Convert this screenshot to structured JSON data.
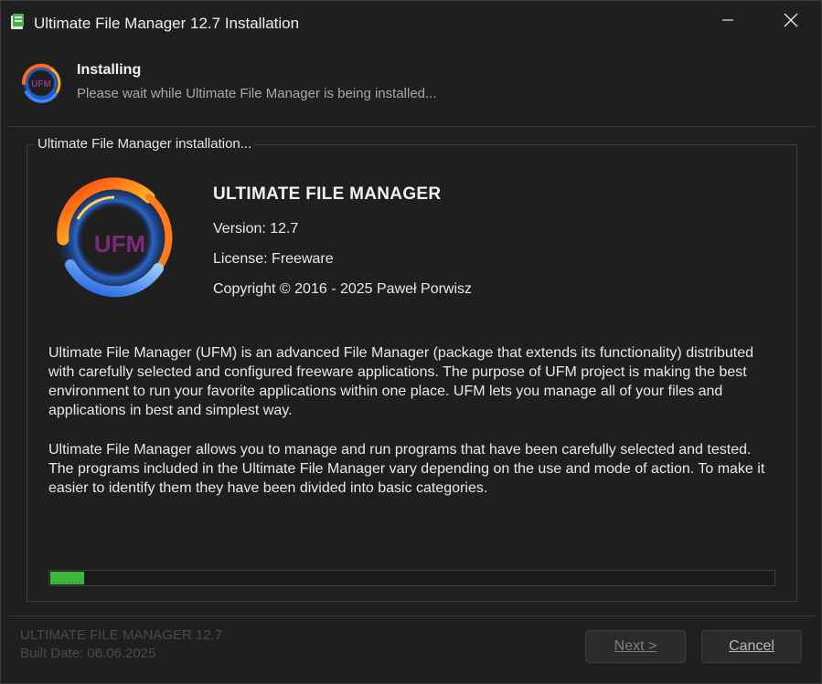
{
  "window": {
    "title": "Ultimate File Manager 12.7 Installation",
    "icons": {
      "app": "installer-app-icon",
      "minimize": "minimize-icon",
      "close": "close-icon"
    }
  },
  "header": {
    "title": "Installing",
    "subtitle": "Please wait while Ultimate File Manager is being installed...",
    "logo_text": "UFM"
  },
  "group": {
    "label": "Ultimate File Manager installation...",
    "logo_text": "UFM",
    "product_name": "ULTIMATE FILE MANAGER",
    "version": "Version: 12.7",
    "license": "License: Freeware",
    "copyright": "Copyright © 2016 - 2025 Paweł Porwisz",
    "description_1": "Ultimate File Manager (UFM) is an advanced File Manager (package that extends its functionality) distributed with carefully selected and configured freeware applications. The purpose of UFM project is making the best environment to run your favorite applications within one place. UFM lets you manage all of your files and applications in best and simplest way.",
    "description_2": "Ultimate File Manager allows you to manage and run programs that have been carefully selected and tested. The programs included in the Ultimate File Manager vary depending on the use and mode of action. To make it easier to identify them they have been divided into basic categories."
  },
  "progress": {
    "fraction": 0.047,
    "color": "#3cb83c"
  },
  "footer": {
    "product": "ULTIMATE FILE MANAGER 12.7",
    "build_date": "Built Date: 06.06.2025"
  },
  "buttons": {
    "next": "Next >",
    "cancel": "Cancel"
  },
  "colors": {
    "background": "#1f1f1f",
    "accent": "#3cb83c"
  }
}
